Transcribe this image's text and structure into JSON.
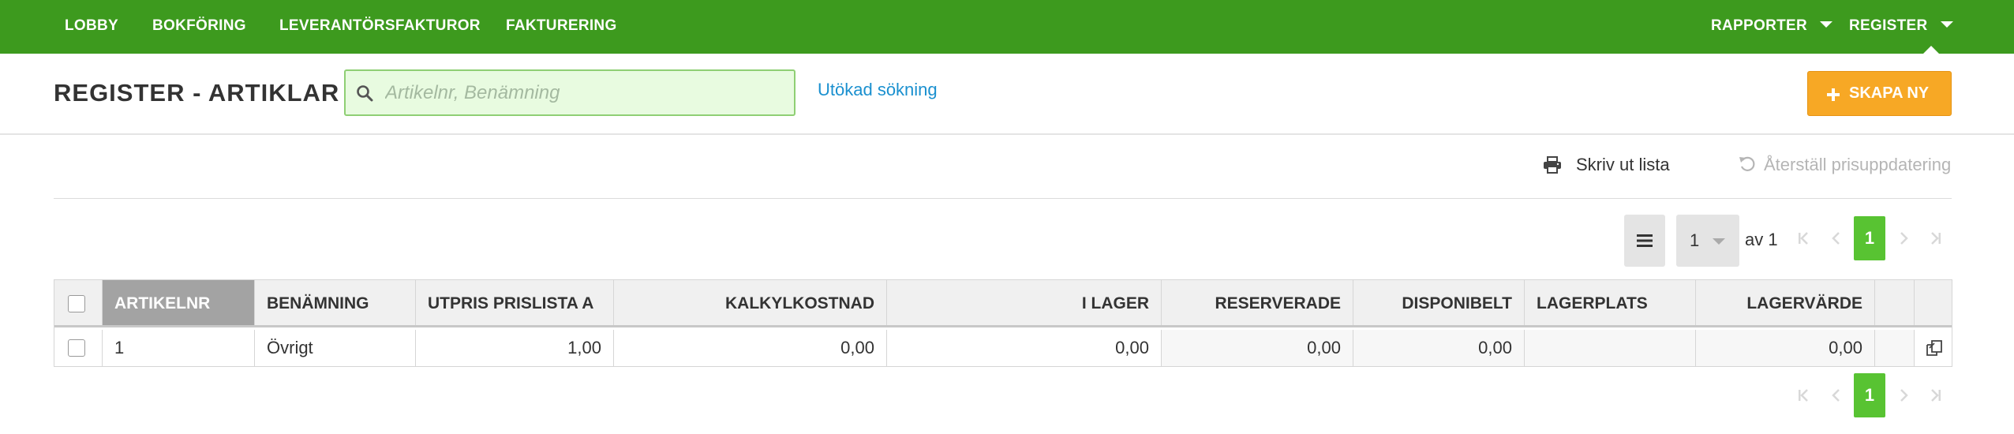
{
  "nav": {
    "left_items": [
      "LOBBY",
      "BOKFÖRING",
      "LEVERANTÖRSFAKTUROR",
      "FAKTURERING"
    ],
    "right_items": [
      "RAPPORTER",
      "REGISTER"
    ],
    "active_item": "REGISTER",
    "icons": {
      "dropdown": "chevron-down-icon"
    }
  },
  "header": {
    "title": "REGISTER - ARTIKLAR",
    "search_placeholder": "Artikelnr, Benämning",
    "search_value": "",
    "advanced_search_label": "Utökad sökning",
    "create_button_label": "SKAPA NY"
  },
  "toolbar": {
    "print_label": "Skriv ut lista",
    "reset_label": "Återställ prisuppdatering"
  },
  "pagination": {
    "page_selected": "1",
    "of_label": "av 1",
    "current_page": "1"
  },
  "table": {
    "columns": [
      "ARTIKELNR",
      "BENÄMNING",
      "UTPRIS PRISLISTA A",
      "KALKYLKOSTNAD",
      "I LAGER",
      "RESERVERADE",
      "DISPONIBELT",
      "LAGERPLATS",
      "LAGERVÄRDE"
    ],
    "sorted_column": "ARTIKELNR",
    "rows": [
      {
        "artikelnr": "1",
        "benamning": "Övrigt",
        "utpris": "1,00",
        "kalkylkostnad": "0,00",
        "i_lager": "0,00",
        "reserverade": "0,00",
        "disponibelt": "0,00",
        "lagerplats": "",
        "lagervarde": "0,00"
      }
    ]
  },
  "colors": {
    "nav_bg": "#3d9a1e",
    "create_button": "#f7a825",
    "current_page": "#58c332",
    "link": "#1a90cf",
    "search_bg": "#e8fbe0"
  }
}
